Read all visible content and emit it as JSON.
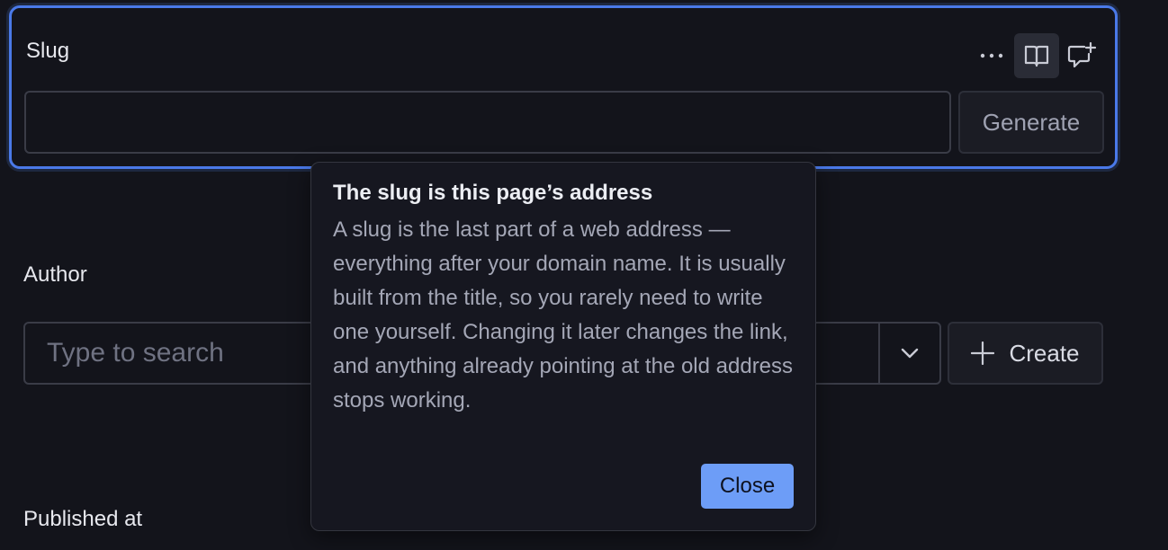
{
  "slug_field": {
    "label": "Slug",
    "value": "",
    "generate_label": "Generate",
    "toolbar": {
      "more_icon": "more-horizontal-icon",
      "docs_icon": "book-open-icon",
      "comment_icon": "comment-add-icon"
    }
  },
  "author_field": {
    "label": "Author",
    "placeholder": "Type to search",
    "create_label": "Create"
  },
  "published_field": {
    "label": "Published at"
  },
  "popover": {
    "title": "The slug is this page’s address",
    "body": "A slug is the last part of a web address — everything after your domain name. It is usually built from the title, so you rarely need to write one yourself. Changing it later changes the link, and anything already pointing at the old address stops working.",
    "close_label": "Close"
  },
  "colors": {
    "accent": "#4a79e8",
    "primary_button": "#6d9df7",
    "background": "#13141b"
  }
}
